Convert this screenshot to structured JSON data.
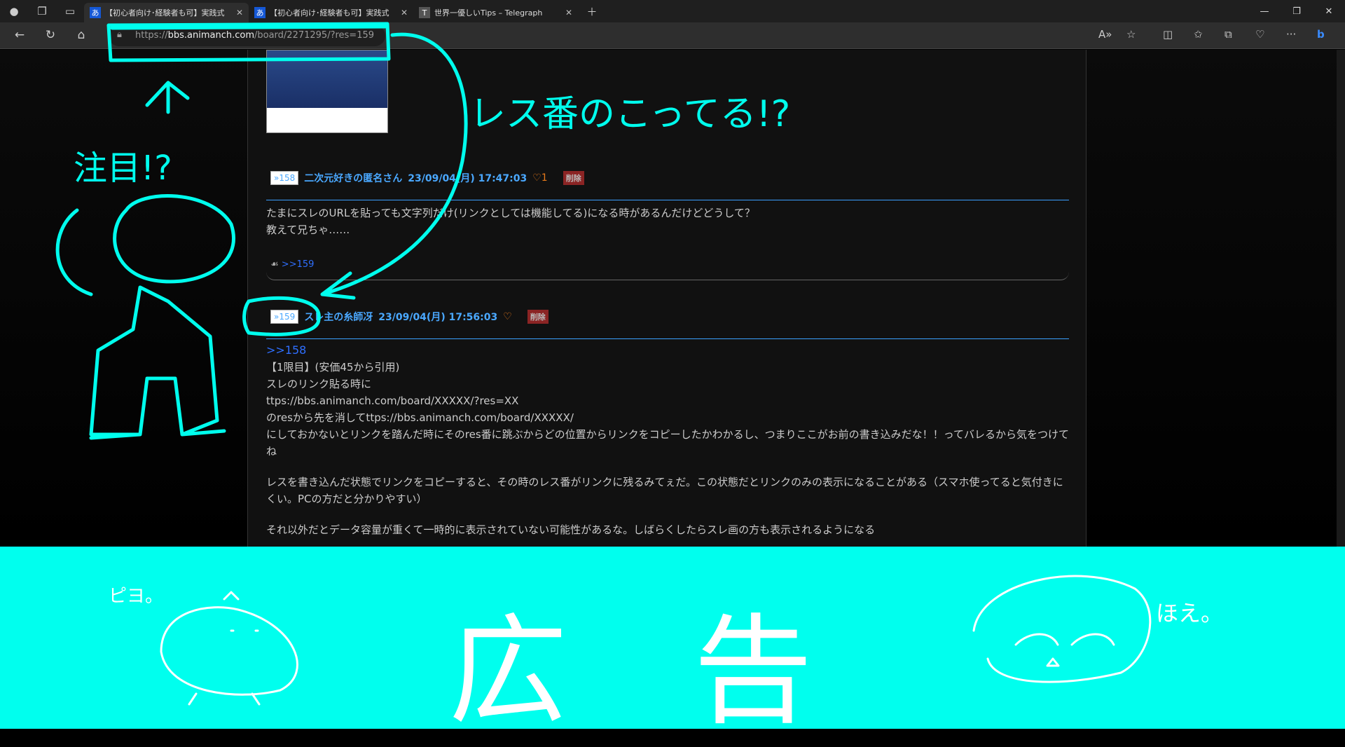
{
  "browser": {
    "tabs": [
      {
        "favicon": "あ",
        "title": "【初心者向け･経験者も可】実践式",
        "active": true
      },
      {
        "favicon": "あ",
        "title": "【初心者向け･経験者も可】実践式",
        "active": false
      },
      {
        "favicon": "T",
        "title": "世界一優しいTips – Telegraph",
        "active": false
      }
    ],
    "url_prefix": "https://",
    "url_host": "bbs.animanch.com",
    "url_path": "/board/2271295/?res=159"
  },
  "posts": [
    {
      "num": "»158",
      "name": "二次元好きの匿名さん",
      "date": "23/09/04(月) 17:47:03",
      "likes": "♡1",
      "delete": "削除",
      "lines": [
        "たまにスレのURLを貼っても文字列だけ(リンクとしては機能してる)になる時があるんだけどどうして？",
        "教えて兄ちゃ……"
      ],
      "reply": ">>159"
    },
    {
      "num": "»159",
      "name": "スレ主の糸師冴",
      "date": "23/09/04(月) 17:56:03",
      "likes": "♡",
      "delete": "削除",
      "anchor": ">>158",
      "lines": [
        "【1限目】(安価45から引用)",
        "スレのリンク貼る時に",
        "ttps://bbs.animanch.com/board/XXXXX/?res=XX",
        "のresから先を消してttps://bbs.animanch.com/board/XXXXX/",
        "にしておかないとリンクを踏んだ時にそのres番に跳ぶからどの位置からリンクをコピーしたかわかるし、つまりここがお前の書き込みだな！！ってバレるから気をつけてね"
      ],
      "para2": "レスを書き込んだ状態でリンクをコピーすると、その時のレス番がリンクに残るみてぇだ。この状態だとリンクのみの表示になることがある（スマホ使ってると気付きにくい。PCの方だと分かりやすい）",
      "para3": "それ以外だとデータ容量が重くて一時的に表示されていない可能性があるな。しばらくしたらスレ画の方も表示されるようになる"
    }
  ],
  "annotations": {
    "note1": "レス番のこってる!?",
    "note2": "注目!?",
    "ad_label": "広告",
    "chick": "ピヨ。",
    "girl": "ほえ。"
  },
  "colors": {
    "annotation": "#00ffee",
    "accent": "#4aa8ff"
  }
}
